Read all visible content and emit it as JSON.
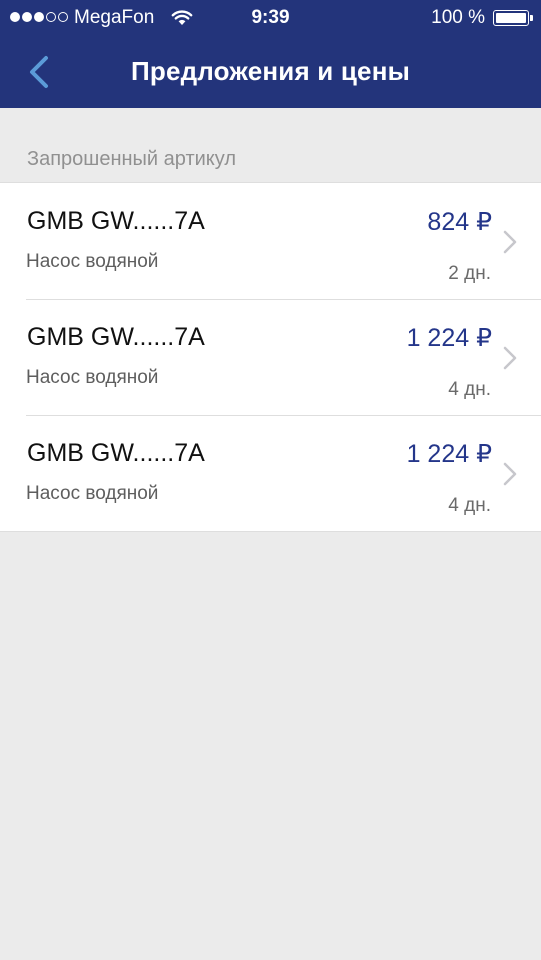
{
  "status_bar": {
    "carrier": "MegaFon",
    "time": "9:39",
    "battery_percent": "100 %",
    "battery_level": 1.0,
    "signal_bars_filled": 3,
    "signal_bars_total": 5
  },
  "nav": {
    "title": "Предложения и цены",
    "back_icon": "chevron-left-icon"
  },
  "section": {
    "header": "Запрошенный артикул"
  },
  "offers": [
    {
      "article": "GMB GW......7A",
      "description": "Насос водяной",
      "price": "824 ₽",
      "delivery": "2 дн."
    },
    {
      "article": "GMB GW......7A",
      "description": "Насос водяной",
      "price": "1 224 ₽",
      "delivery": "4 дн."
    },
    {
      "article": "GMB GW......7A",
      "description": "Насос водяной",
      "price": "1 224 ₽",
      "delivery": "4 дн."
    }
  ],
  "colors": {
    "nav_background": "#23347b",
    "accent_back": "#5b9bd8",
    "price": "#24368a",
    "page_background": "#ebebeb"
  }
}
